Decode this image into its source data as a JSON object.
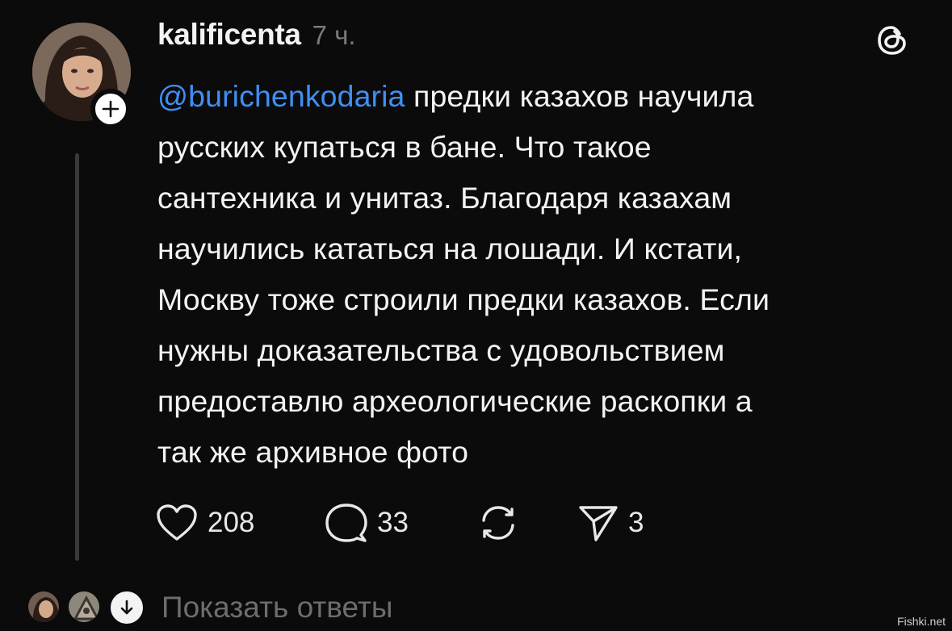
{
  "post": {
    "username": "kalificenta",
    "time": "7 ч.",
    "mention": "@burichenkodaria",
    "lines": [
      " предки казахов научила",
      "русских купаться в бане. Что такое",
      "сантехника и унитаз. Благодаря казахам",
      "научились кататься на лошади. И кстати,",
      "Москву тоже строили предки казахов. Если",
      "нужны доказательства с удовольствием",
      "предоставлю археологические раскопки а",
      "так же архивное фото"
    ]
  },
  "actions": {
    "likes": "208",
    "comments": "33",
    "shares": "3"
  },
  "footer": {
    "show_replies": "Показать ответы"
  },
  "watermark": "Fishki.net",
  "icons": {
    "app": "threads-icon",
    "like": "heart-icon",
    "comment": "comment-bubble-icon",
    "repost": "repost-icon",
    "share": "send-icon",
    "follow": "plus-icon",
    "expand": "arrow-down-icon"
  },
  "colors": {
    "background": "#0b0b0b",
    "text": "#f3f3f3",
    "mention": "#3f8ff2",
    "muted": "#7a7a7a"
  }
}
